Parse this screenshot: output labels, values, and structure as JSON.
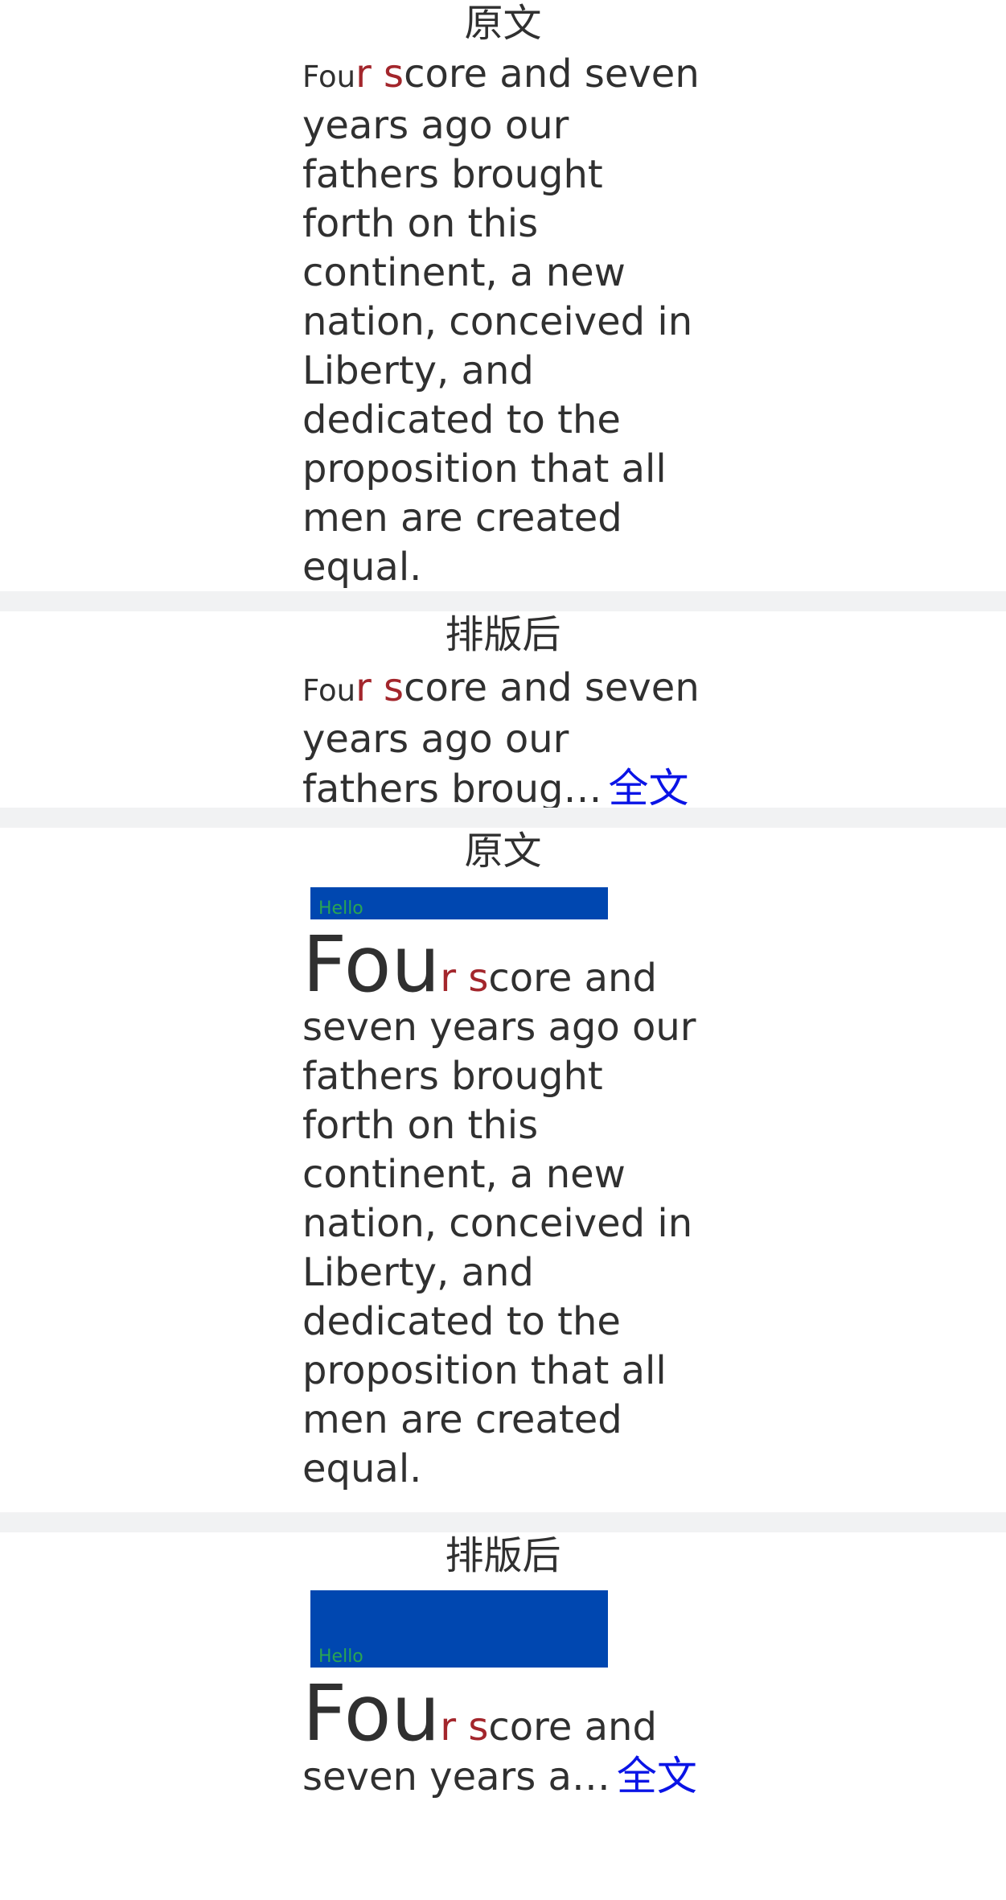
{
  "blocks": [
    {
      "title": "原文",
      "lead_small": "Fou",
      "lead_red": "r s",
      "body": "core and seven years ago our fathers brought forth on this continent, a new nation, conceived in Liberty, and dedicated to the proposition that all men are created equal."
    },
    {
      "title": "排版后",
      "lead_small": "Fou",
      "lead_red": "r s",
      "body_lines": [
        "core and seven",
        "years ago our",
        "fathers broug…"
      ],
      "more_label": "全文"
    },
    {
      "title": "原文",
      "hello": "Hello",
      "lead_big": "Fou",
      "lead_red": "r s",
      "body": "core and seven years ago our fathers brought forth on this continent, a new nation, conceived in Liberty, and dedicated to the proposition that all men are created equal."
    },
    {
      "title": "排版后",
      "hello": "Hello",
      "lead_big": "Fou",
      "lead_red": "r s",
      "body_lines": [
        "core and",
        "seven years a…"
      ],
      "more_label": "全文"
    }
  ],
  "colors": {
    "text": "#303030",
    "accent_red": "#a3262c",
    "link_blue": "#0a14e6",
    "box_blue": "#0047b0",
    "hello_green": "#2aa552",
    "divider": "#f1f2f3"
  }
}
